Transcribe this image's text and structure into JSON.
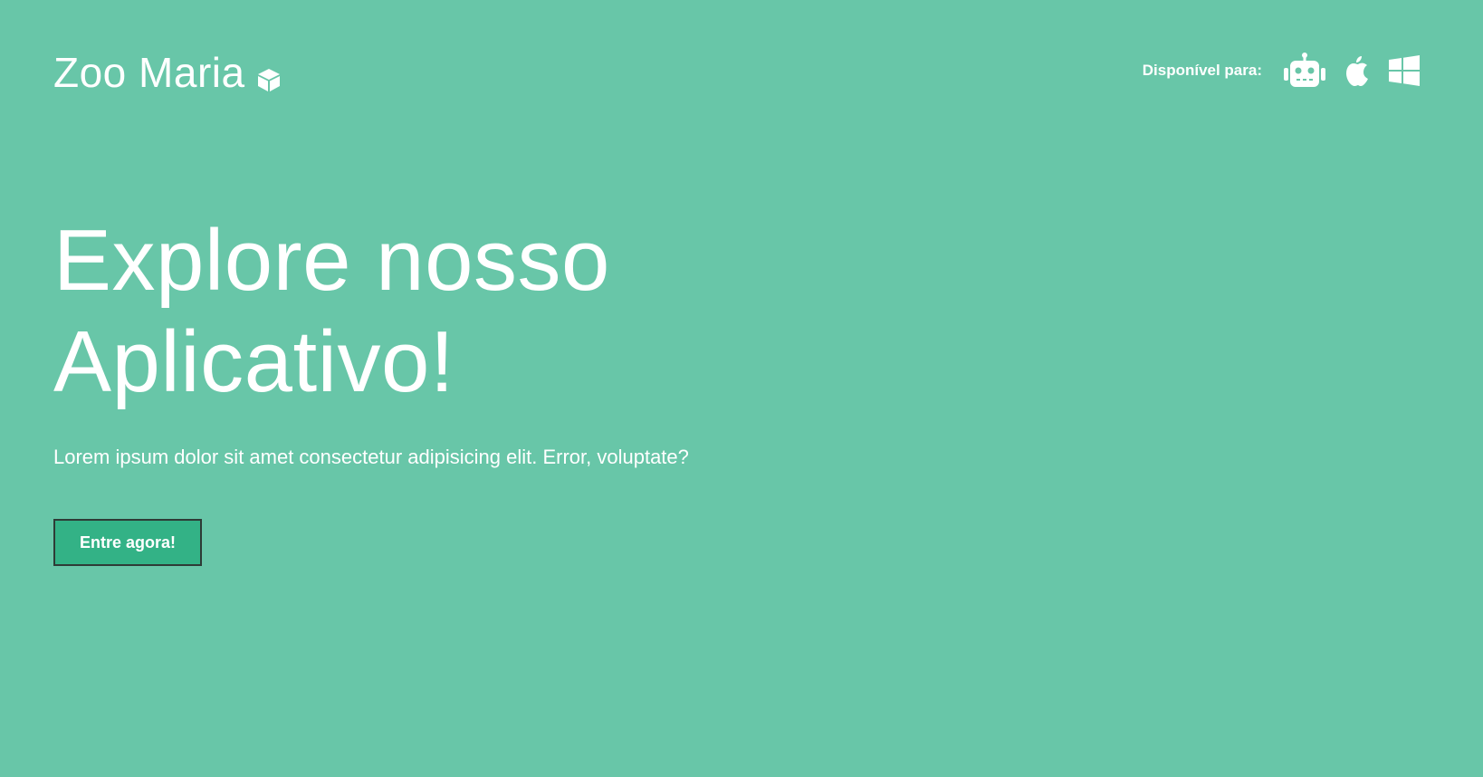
{
  "brand": {
    "name": "Zoo Maria",
    "icon": "cube-icon"
  },
  "platforms": {
    "label": "Disponível para:",
    "items": [
      {
        "name": "Android",
        "icon": "android-robot-icon"
      },
      {
        "name": "Apple",
        "icon": "apple-icon"
      },
      {
        "name": "Windows",
        "icon": "windows-icon"
      }
    ]
  },
  "hero": {
    "title_line1": "Explore nosso",
    "title_line2": "Aplicativo!",
    "subtitle": "Lorem ipsum dolor sit amet consectetur adipisicing elit. Error, voluptate?",
    "cta_label": "Entre agora!"
  },
  "colors": {
    "background": "#68c6a8",
    "button": "#33b286",
    "text": "#ffffff"
  }
}
